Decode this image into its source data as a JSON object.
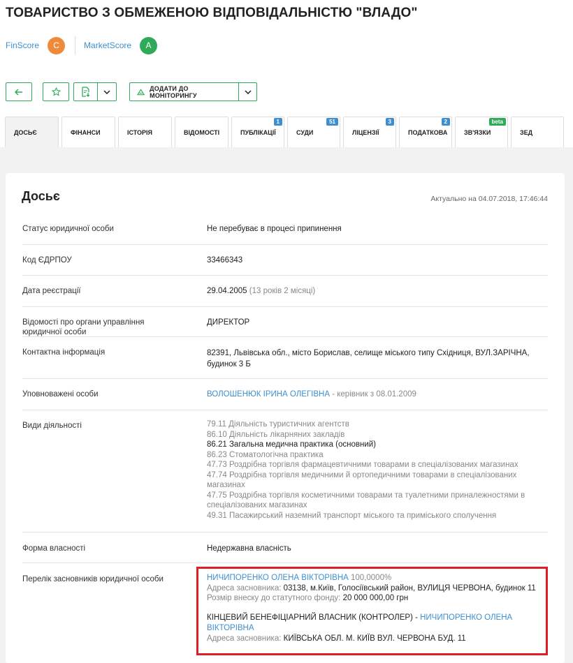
{
  "company_title": "ТОВАРИСТВО З ОБМЕЖЕНОЮ ВІДПОВІДАЛЬНІСТЮ \"ВЛАДО\"",
  "scores": {
    "finscore_label": "FinScore",
    "finscore_grade": "C",
    "finscore_color": "#ef8a3a",
    "marketscore_label": "MarketScore",
    "marketscore_grade": "A",
    "marketscore_color": "#2eaa58"
  },
  "toolbar": {
    "back_icon": "arrow-left-icon",
    "favorite_icon": "star-icon",
    "export_icon": "file-download-icon",
    "dropdown_icon": "chevron-down-icon",
    "monitor_icon": "monitor-triangle-icon",
    "monitor_label": "ДОДАТИ ДО МОНІТОРИНГУ"
  },
  "tabs": [
    {
      "label": "ДОСЬЄ",
      "badge": ""
    },
    {
      "label": "ФІНАНСИ",
      "badge": ""
    },
    {
      "label": "ІСТОРІЯ",
      "badge": ""
    },
    {
      "label": "ВІДОМОСТІ",
      "badge": ""
    },
    {
      "label": "ПУБЛІКАЦІЇ",
      "badge": "1"
    },
    {
      "label": "СУДИ",
      "badge": "51"
    },
    {
      "label": "ЛІЦЕНЗІЇ",
      "badge": "3"
    },
    {
      "label": "ПОДАТКОВА",
      "badge": "2"
    },
    {
      "label": "ЗВ'ЯЗКИ",
      "badge": "beta"
    },
    {
      "label": "ЗЕД",
      "badge": ""
    }
  ],
  "dossier": {
    "title": "Досьє",
    "updated": "Актуально на 04.07.2018, 17:46:44",
    "status_label": "Статус юридичної особи",
    "status_value": "Не перебуває в процесі припинення",
    "edrpou_label": "Код ЄДРПОУ",
    "edrpou_value": "33466343",
    "reg_label": "Дата реєстрації",
    "reg_date": "29.04.2005",
    "reg_age": "(13 років 2 місяці)",
    "mgmt_label": "Відомості про органи управління юридичної особи",
    "mgmt_value": "ДИРЕКТОР",
    "contact_label": "Контактна інформація",
    "contact_value": "82391, Львівська обл., місто Борислав, селище міського типу Східниця, ВУЛ.ЗАРІЧНА, будинок 3 Б",
    "authorized_label": "Уповноважені особи",
    "authorized_name": "ВОЛОШЕНЮК ІРИНА ОЛЕГІВНА",
    "authorized_role": " - керівник з 08.01.2009",
    "activities_label": "Види діяльності",
    "activities": [
      "79.11 Діяльність туристичних агентств",
      "86.10 Діяльність лікарняних закладів",
      "86.21 Загальна медична практика (основний)",
      "86.23 Стоматологічна практика",
      "47.73 Роздрібна торгівля фармацевтичними товарами в спеціалізованих магазинах",
      "47.74 Роздрібна торгівля медичними й ортопедичними товарами в спеціалізованих магазинах",
      "47.75 Роздрібна торгівля косметичними товарами та туалетними приналежностями в спеціалізованих магазинах",
      "49.31 Пасажирський наземний транспорт міського та приміського сполучення"
    ],
    "ownership_label": "Форма власності",
    "ownership_value": "Недержавна власність",
    "founders_label": "Перелік засновників юридичної особи",
    "founder_name": "НИЧИПОРЕНКО ОЛЕНА ВІКТОРІВНА",
    "founder_share": " 100,0000%",
    "founder_addr_label": "Адреса засновника: ",
    "founder_addr": "03138, м.Київ, Голосіївський район, ВУЛИЦЯ ЧЕРВОНА, будинок 11",
    "founder_capital_label": "Розмір внеску до статутного фонду: ",
    "founder_capital": "20 000 000,00 грн",
    "beneficiary_label": "КІНЦЕВИЙ БЕНЕФІЦІАРНИЙ ВЛАСНИК (КОНТРОЛЕР) - ",
    "beneficiary_name": "НИЧИПОРЕНКО ОЛЕНА ВІКТОРІВНА",
    "beneficiary_addr_label": "Адреса засновника: ",
    "beneficiary_addr": "КИЇВСЬКА ОБЛ. М. КИЇВ ВУЛ. ЧЕРВОНА БУД. 11"
  }
}
